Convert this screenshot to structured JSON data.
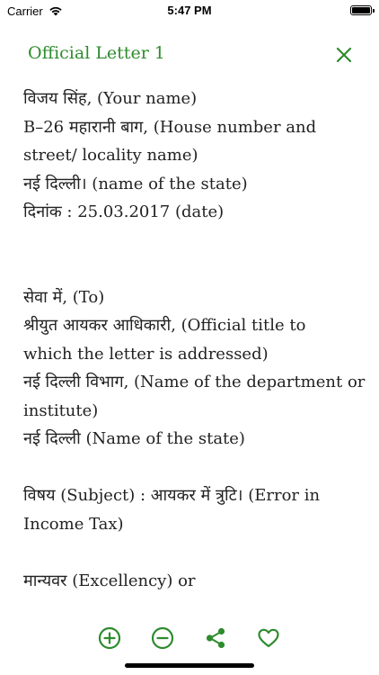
{
  "status_bar": {
    "carrier": "Carrier",
    "time": "5:47 PM"
  },
  "header": {
    "title": "Official Letter 1"
  },
  "letter_lines": [
    "विजय सिंह, (Your name)",
    "B–26 महारानी बाग, (House number and",
    "street/ locality name)",
    "नई दिल्ली। (name of the state)",
    "दिनांक : 25.03.2017 (date)",
    "",
    "",
    "सेवा में, (To)",
    "श्रीयुत आयकर आधिकारी, (Official title to",
    "which the letter is addressed)",
    "नई दिल्ली विभाग, (Name of the department or",
    "institute)",
    "नई दिल्ली (Name of the state)",
    "",
    "विषय (Subject) : आयकर में त्रुटि। (Error in",
    "Income Tax)",
    "",
    "मान्यवर (Excellency) or"
  ],
  "colors": {
    "accent": "#2e8b2e",
    "text": "#222222"
  },
  "toolbar": {
    "icons": [
      "zoom-in-icon",
      "zoom-out-icon",
      "share-icon",
      "heart-icon"
    ]
  }
}
